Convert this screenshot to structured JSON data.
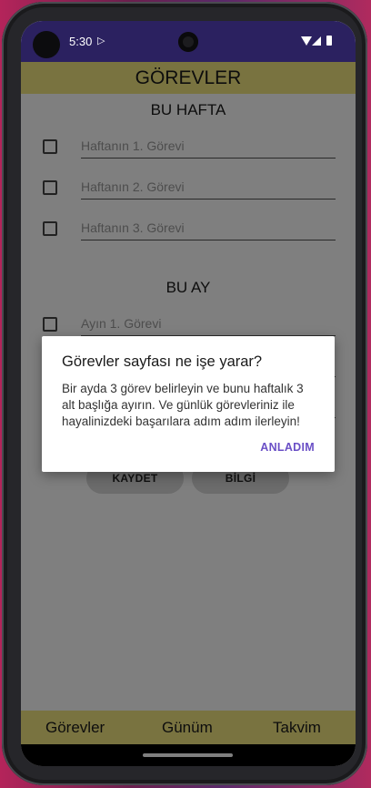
{
  "status_bar": {
    "time": "5:30",
    "icons": [
      "play-store-icon",
      "wifi-icon",
      "signal-icon",
      "battery-icon"
    ]
  },
  "app": {
    "title": "GÖREVLER",
    "header_color": "#f2e680",
    "week_section": {
      "title": "BU HAFTA",
      "tasks": [
        {
          "placeholder": "Haftanın 1. Görevi"
        },
        {
          "placeholder": "Haftanın 2. Görevi"
        },
        {
          "placeholder": "Haftanın 3. Görevi"
        }
      ]
    },
    "month_section": {
      "title": "BU AY",
      "tasks": [
        {
          "placeholder": "Ayın 1. Görevi"
        },
        {
          "placeholder": ""
        },
        {
          "placeholder": ""
        }
      ]
    },
    "buttons": {
      "save": "KAYDET",
      "info": "BİLGİ"
    },
    "bottom_nav": [
      "Görevler",
      "Günüm",
      "Takvim"
    ]
  },
  "dialog": {
    "title": "Görevler sayfası ne işe yarar?",
    "message": "Bir ayda 3 görev belirleyin ve bunu haftalık 3 alt başlığa ayırın. Ve günlük görevleriniz ile hayalinizdeki başarılara adım adım ilerleyin!",
    "button": "ANLADIM",
    "accent_color": "#6a4fc6"
  }
}
